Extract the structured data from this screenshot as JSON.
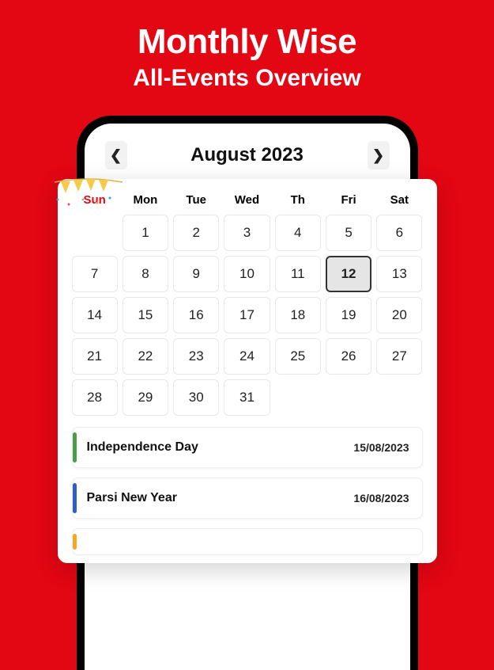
{
  "header": {
    "title": "Monthly Wise",
    "subtitle": "All-Events Overview"
  },
  "month": {
    "label": "August 2023"
  },
  "dayHeaders": [
    "Sun",
    "Mon",
    "Tue",
    "Wed",
    "Th",
    "Fri",
    "Sat"
  ],
  "calendar": {
    "leadingEmpty": 1,
    "daysInMonth": 31,
    "highlightedDay": 12
  },
  "events": [
    {
      "name": "Independence Day",
      "date": "15/08/2023",
      "color": "green"
    },
    {
      "name": "Parsi New Year",
      "date": "16/08/2023",
      "color": "blue"
    },
    {
      "name": "",
      "date": "",
      "color": "orange"
    }
  ]
}
